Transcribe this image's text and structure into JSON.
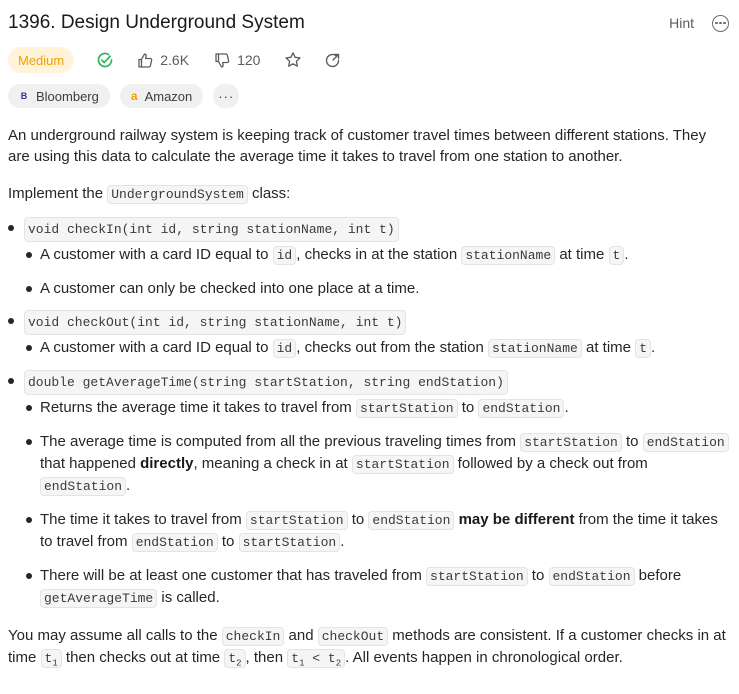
{
  "problem": {
    "title": "1396. Design Underground System",
    "hint_label": "Hint"
  },
  "meta": {
    "difficulty": "Medium",
    "likes": "2.6K",
    "dislikes": "120",
    "colors": {
      "difficulty_text": "#f0a000",
      "difficulty_bg": "#fff3da",
      "solved_check": "#2db55d"
    }
  },
  "tags": {
    "companies": [
      {
        "icon": "bloomberg-logo",
        "logo_text": "B",
        "label": "Bloomberg"
      },
      {
        "icon": "amazon-logo",
        "logo_text": "a",
        "label": "Amazon"
      }
    ],
    "more": "···"
  },
  "description": {
    "intro": "An underground railway system is keeping track of customer travel times between different stations. They are using this data to calculate the average time it takes to travel from one station to another.",
    "impl_prefix": "Implement the ",
    "impl_class": "UndergroundSystem",
    "impl_suffix": " class:",
    "methods": [
      {
        "signature": "void checkIn(int id, string stationName, int t)",
        "notes": [
          {
            "t1": "A customer with a card ID equal to ",
            "c1": "id",
            "t2": ", checks in at the station ",
            "c2": "stationName",
            "t3": " at time ",
            "c3": "t",
            "t4": "."
          },
          {
            "text": "A customer can only be checked into one place at a time."
          }
        ]
      },
      {
        "signature": "void checkOut(int id, string stationName, int t)",
        "notes": [
          {
            "t1": "A customer with a card ID equal to ",
            "c1": "id",
            "t2": ", checks out from the station ",
            "c2": "stationName",
            "t3": " at time ",
            "c3": "t",
            "t4": "."
          }
        ]
      },
      {
        "signature": "double getAverageTime(string startStation, string endStation)",
        "notes": [
          {
            "t1": "Returns the average time it takes to travel from ",
            "c1": "startStation",
            "t2": " to ",
            "c2": "endStation",
            "t3": "."
          },
          {
            "t1": "The average time is computed from all the previous traveling times from ",
            "c1": "startStation",
            "t2": " to ",
            "c2": "endStation",
            "t3": " that happened ",
            "b1": "directly",
            "t4": ", meaning a check in at ",
            "c3": "startStation",
            "t5": " followed by a check out from ",
            "c4": "endStation",
            "t6": "."
          },
          {
            "t1": "The time it takes to travel from ",
            "c1": "startStation",
            "t2": " to ",
            "c2": "endStation",
            "t3": " ",
            "b1": "may be different",
            "t4": " from the time it takes to travel from ",
            "c3": "endStation",
            "t5": " to ",
            "c4": "startStation",
            "t6": "."
          },
          {
            "t1": "There will be at least one customer that has traveled from ",
            "c1": "startStation",
            "t2": " to ",
            "c2": "endStation",
            "t3": " before ",
            "c3": "getAverageTime",
            "t4": " is called."
          }
        ]
      }
    ],
    "closing": {
      "t1": "You may assume all calls to the ",
      "c1": "checkIn",
      "t2": " and ",
      "c2": "checkOut",
      "t3": " methods are consistent. If a customer checks in at time ",
      "c3_base": "t",
      "c3_sub": "1",
      "t4": " then checks out at time ",
      "c4_base": "t",
      "c4_sub": "2",
      "t5": ", then ",
      "c5_a": "t",
      "c5_a_sub": "1",
      "c5_op": " < ",
      "c5_b": "t",
      "c5_b_sub": "2",
      "t6": ". All events happen in chronological order."
    }
  }
}
